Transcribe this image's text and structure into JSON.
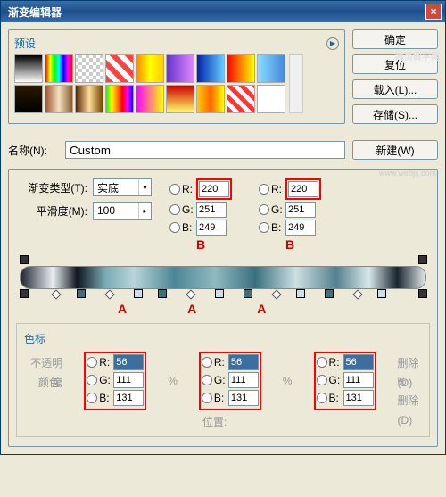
{
  "window": {
    "title": "渐变编辑器"
  },
  "watermark": {
    "top": "网页教学网",
    "bottom": "www.webjx.com"
  },
  "presets": {
    "title": "预设"
  },
  "swatches": [
    "linear-gradient(to bottom,#000,#fff)",
    "linear-gradient(to right,#ff0000,#ffff00,#00ff00,#00ffff,#0000ff,#ff00ff,#ff0000)",
    "repeating-conic-gradient(#ccc 0 25%, #fff 0 50%) 50% / 8px 8px",
    "repeating-linear-gradient(45deg,#ff4040 0 6px,#fff 6px 12px)",
    "linear-gradient(to right,#ff8800,#ffff00,#ffcc00)",
    "linear-gradient(to right,#6633cc,#dd88ff)",
    "linear-gradient(to right,#0022aa,#66ccff)",
    "linear-gradient(to right,#ff0000,#ffff00)",
    "linear-gradient(to right,#88ddff,#4488dd)",
    "linear-gradient(to bottom,#2a1a00,#000)",
    "linear-gradient(to right,#a0522d,#f4e2c0,#8b5a2b)",
    "linear-gradient(to right,#552200,#ffdd99,#774400)",
    "linear-gradient(to right,#00ff00,#ffff00,#ff8800,#ff0000,#ff00ff,#0000ff)",
    "linear-gradient(to right,#ff00ff,#ffff00)",
    "linear-gradient(to bottom,#cc0000,#ffff66)",
    "linear-gradient(to right,#ffcc00,#ff6600,#ffff00)",
    "repeating-linear-gradient(45deg,#ff3333 0 5px,#fff 5px 10px)",
    "#fff"
  ],
  "buttons": {
    "ok": "确定",
    "reset": "复位",
    "load": "载入(L)...",
    "save": "存储(S)...",
    "new": "新建(W)"
  },
  "name": {
    "label": "名称(N):",
    "value": "Custom"
  },
  "gradType": {
    "label": "渐变类型(T):",
    "value": "实底"
  },
  "smoothness": {
    "label": "平滑度(M):",
    "value": "100"
  },
  "rgbTopB1": {
    "r": "220",
    "g": "251",
    "b": "249"
  },
  "rgbTopB2": {
    "r": "220",
    "g": "251",
    "b": "249"
  },
  "labelsTop": {
    "b": "B",
    "b2": "B"
  },
  "labelsBot": {
    "a": "A"
  },
  "stops": {
    "title": "色标",
    "opacityLabel": "不透明度",
    "colorLabel": "颜色:",
    "positionLabel": "位置:",
    "a1": {
      "r": "56",
      "g": "111",
      "b": "131"
    },
    "a2": {
      "r": "56",
      "g": "111",
      "b": "131"
    },
    "a3": {
      "r": "56",
      "g": "111",
      "b": "131"
    },
    "delete": "删除(D)",
    "delete2": "删除(D)"
  }
}
